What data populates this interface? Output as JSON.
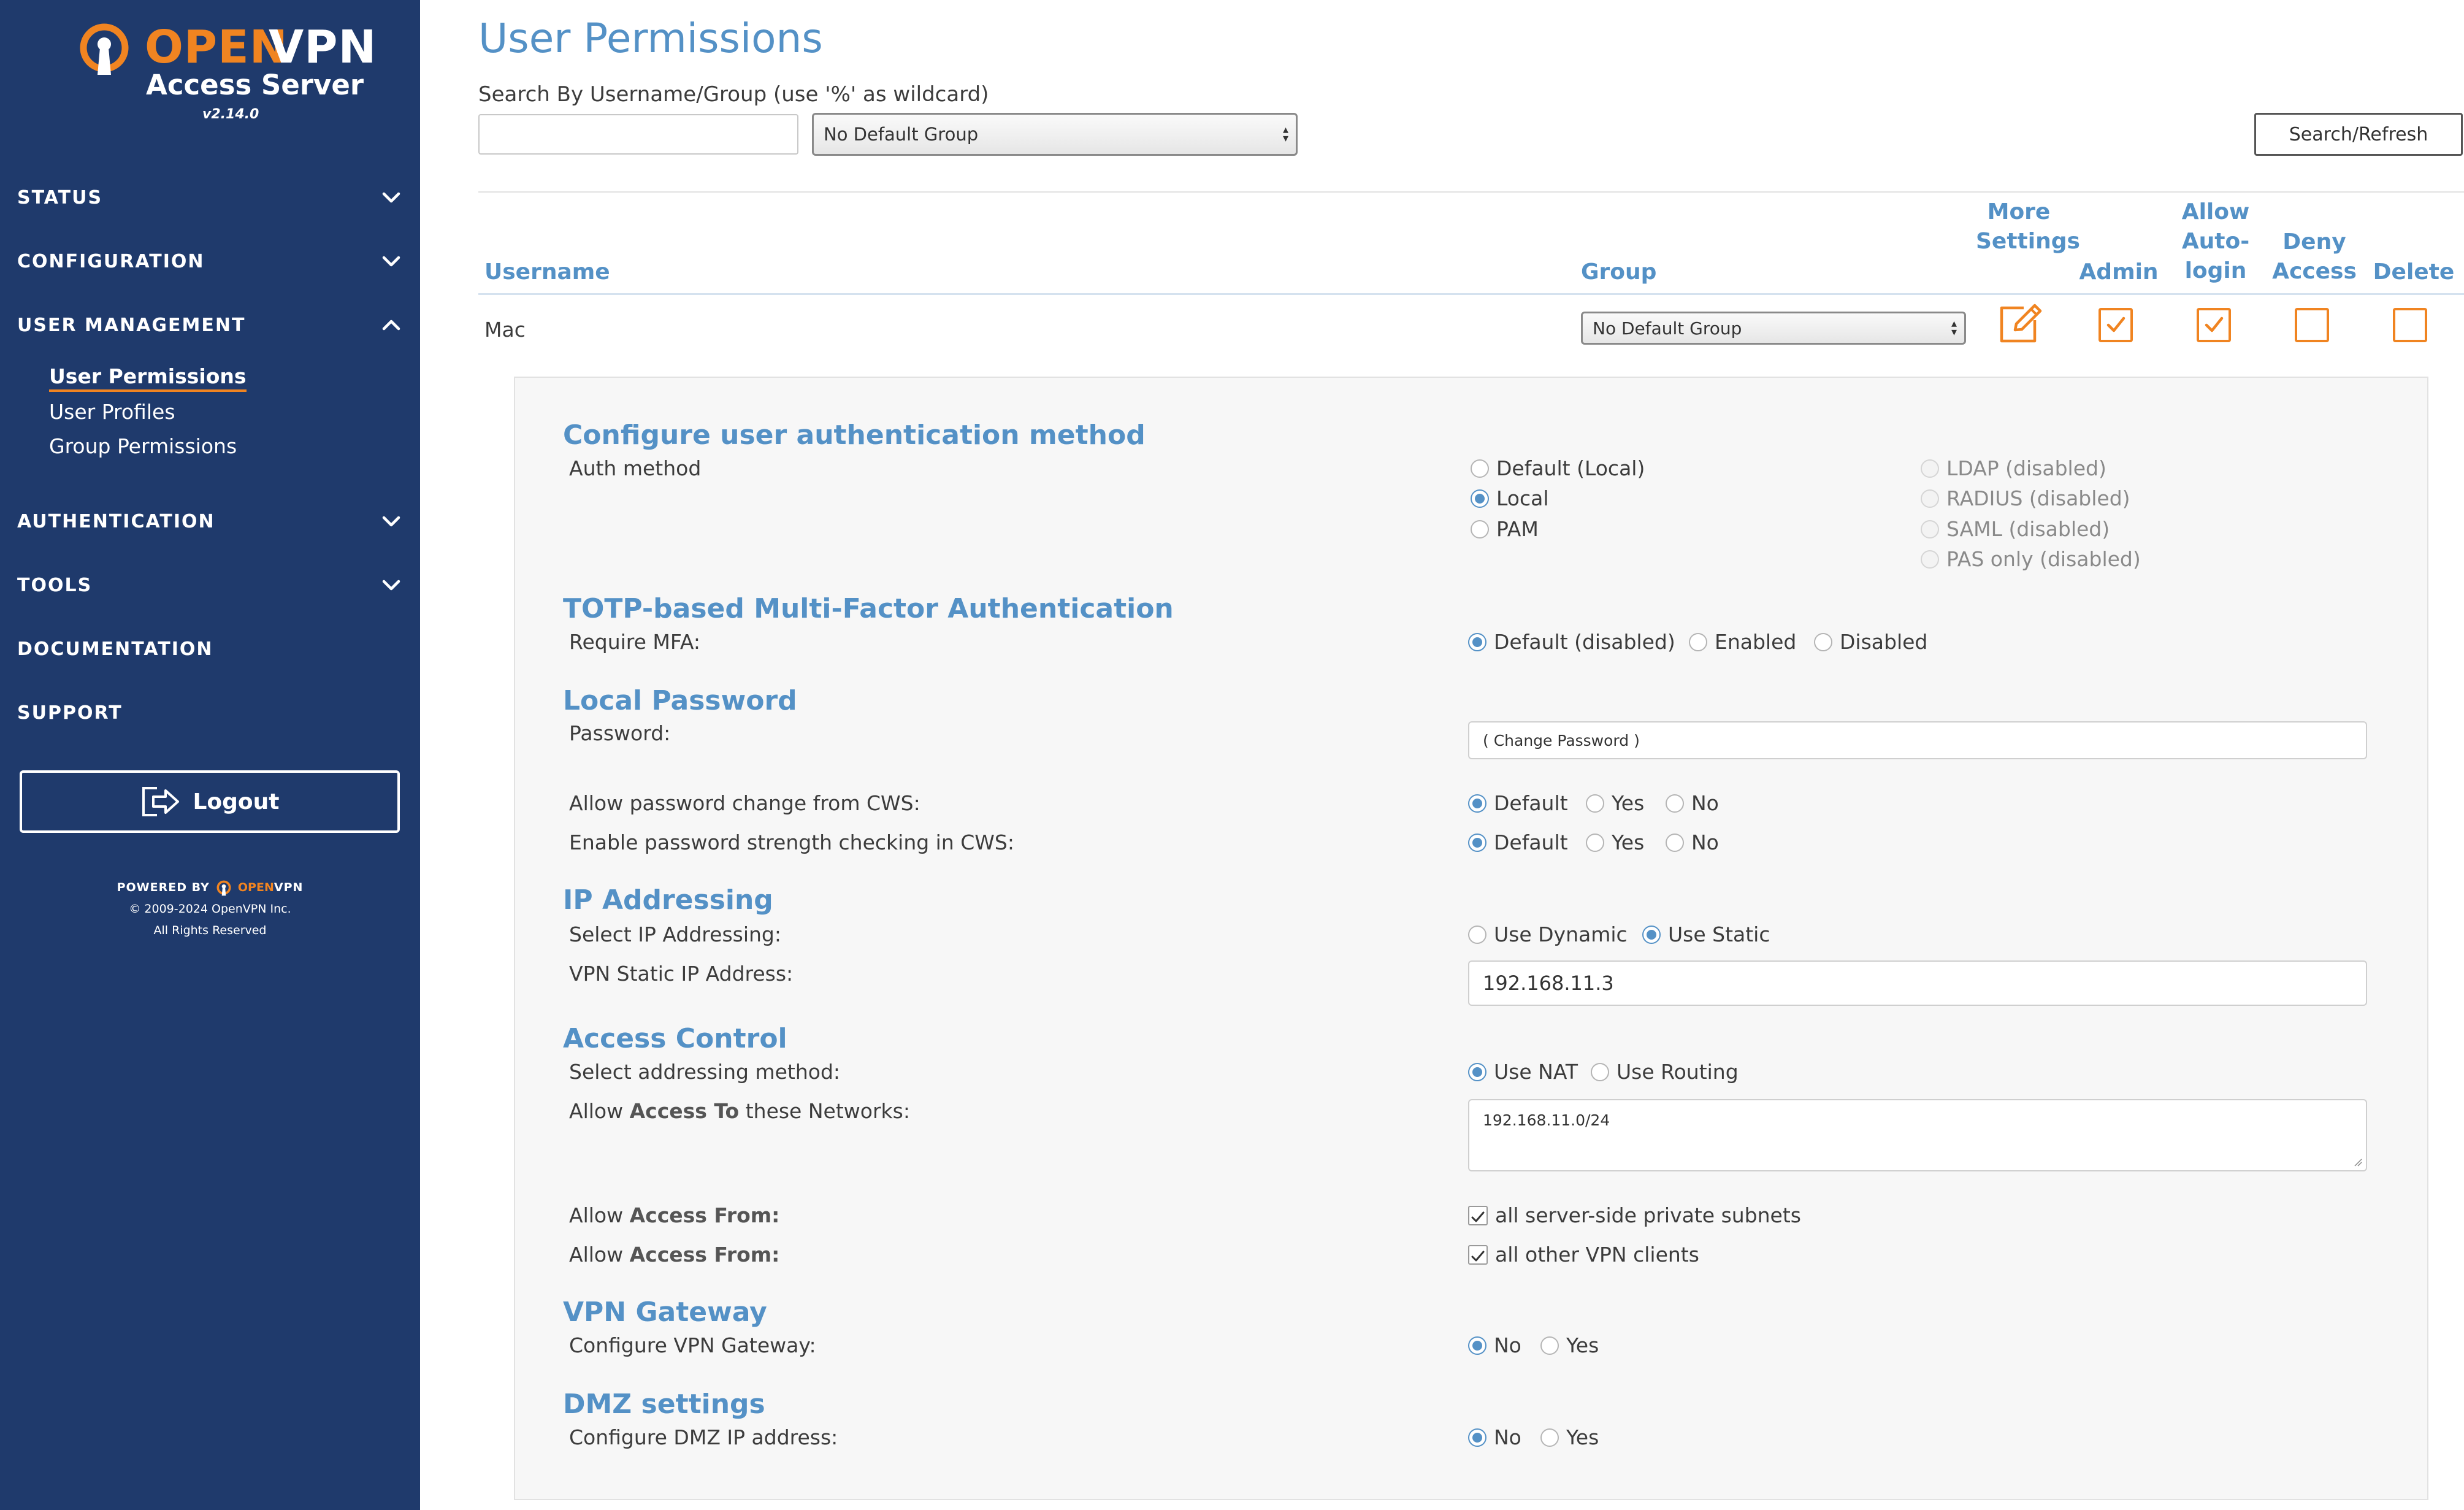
{
  "brand": {
    "name_part1": "OPEN",
    "name_part2": "VPN",
    "product": "Access Server",
    "version": "v2.14.0",
    "accent_color": "#f08421",
    "sidebar_color": "#1f3a6c",
    "link_color": "#5491c6"
  },
  "sidebar": {
    "nav": [
      {
        "label": "STATUS",
        "icon": "chevron-down-icon"
      },
      {
        "label": "CONFIGURATION",
        "icon": "chevron-down-icon"
      },
      {
        "label": "USER MANAGEMENT",
        "icon": "chevron-up-icon"
      },
      {
        "label": "AUTHENTICATION",
        "icon": "chevron-down-icon"
      },
      {
        "label": "TOOLS",
        "icon": "chevron-down-icon"
      },
      {
        "label": "DOCUMENTATION"
      },
      {
        "label": "SUPPORT"
      }
    ],
    "user_management_items": [
      {
        "label": "User Permissions",
        "active": true
      },
      {
        "label": "User Profiles"
      },
      {
        "label": "Group Permissions"
      }
    ],
    "logout_label": "Logout",
    "footer": {
      "powered_by": "POWERED BY",
      "brand_open": "OPEN",
      "brand_vpn": "VPN",
      "copyright": "© 2009-2024 OpenVPN Inc.",
      "rights": "All Rights Reserved"
    }
  },
  "main": {
    "title": "User Permissions",
    "search_label": "Search By Username/Group (use '%' as wildcard)",
    "search_value": "",
    "group_filter": "No Default Group",
    "search_button": "Search/Refresh",
    "table": {
      "headers": {
        "username": "Username",
        "group": "Group",
        "more_settings": "More Settings",
        "admin": "Admin",
        "allow_autologin": "Allow Auto-login",
        "deny_access": "Deny Access",
        "delete": "Delete"
      },
      "rows": [
        {
          "username": "Mac",
          "group": "No Default Group",
          "admin": true,
          "allow_autologin": true,
          "deny_access": false,
          "delete": false
        }
      ]
    }
  },
  "settings": {
    "auth": {
      "title": "Configure user authentication method",
      "label": "Auth method",
      "options_left": [
        "Default (Local)",
        "Local",
        "PAM"
      ],
      "options_right": [
        "LDAP (disabled)",
        "RADIUS (disabled)",
        "SAML (disabled)",
        "PAS only (disabled)"
      ],
      "selected": "Local"
    },
    "mfa": {
      "title": "TOTP-based Multi-Factor Authentication",
      "label": "Require MFA:",
      "options": [
        "Default (disabled)",
        "Enabled",
        "Disabled"
      ],
      "selected": "Default (disabled)"
    },
    "password": {
      "title": "Local Password",
      "label": "Password:",
      "placeholder": "( Change Password )",
      "cws_change_label": "Allow password change from CWS:",
      "cws_strength_label": "Enable password strength checking in CWS:",
      "options": [
        "Default",
        "Yes",
        "No"
      ],
      "cws_change_selected": "Default",
      "cws_strength_selected": "Default"
    },
    "ip": {
      "title": "IP Addressing",
      "select_label": "Select IP Addressing:",
      "options": [
        "Use Dynamic",
        "Use Static"
      ],
      "selected": "Use Static",
      "static_label": "VPN Static IP Address:",
      "static_value": "192.168.11.3"
    },
    "access": {
      "title": "Access Control",
      "method_label": "Select addressing method:",
      "method_options": [
        "Use NAT",
        "Use Routing"
      ],
      "method_selected": "Use NAT",
      "networks_prefix": "Allow ",
      "networks_bold": "Access To",
      "networks_suffix": " these Networks:",
      "networks_value": "192.168.11.0/24",
      "from_prefix": "Allow ",
      "from_bold": "Access From:",
      "from_1": "all server-side private subnets",
      "from_2": "all other VPN clients"
    },
    "gateway": {
      "title": "VPN Gateway",
      "label": "Configure VPN Gateway:",
      "options": [
        "No",
        "Yes"
      ],
      "selected": "No"
    },
    "dmz": {
      "title": "DMZ settings",
      "label": "Configure DMZ IP address:",
      "options": [
        "No",
        "Yes"
      ],
      "selected": "No"
    }
  }
}
